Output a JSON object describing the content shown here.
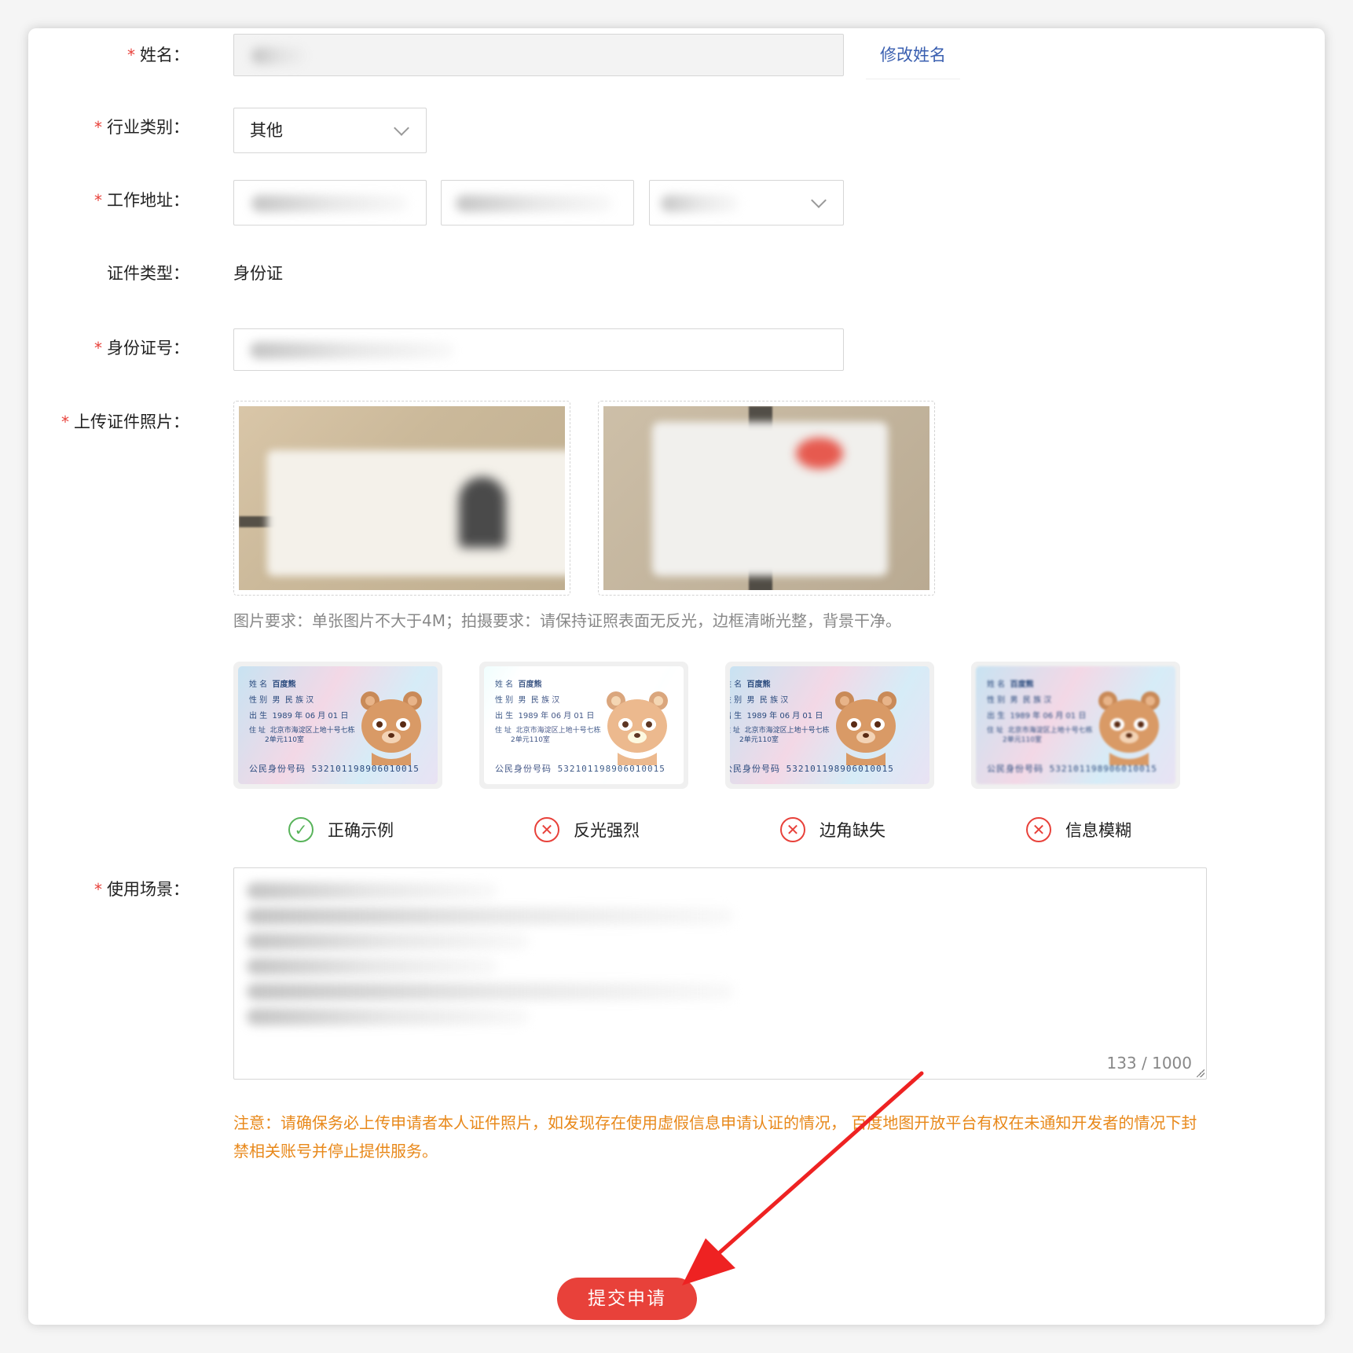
{
  "form": {
    "name": {
      "label": "姓名",
      "colon": "：",
      "edit_label": "修改姓名"
    },
    "industry": {
      "label": "行业类别",
      "colon": "：",
      "value": "其他"
    },
    "address": {
      "label": "工作地址",
      "colon": "："
    },
    "id_type": {
      "label": "证件类型：",
      "value": "身份证"
    },
    "id_number": {
      "label": "身份证号",
      "colon": "："
    },
    "upload": {
      "label": "上传证件照片",
      "colon": "：",
      "hint": "图片要求：单张图片不大于4M；拍摄要求：请保持证照表面无反光，边框清晰光整，背景干净。"
    },
    "samples": [
      {
        "verdict": "正确示例",
        "icon": "check-circle-icon",
        "ok": true
      },
      {
        "verdict": "反光强烈",
        "icon": "x-circle-icon",
        "ok": false
      },
      {
        "verdict": "边角缺失",
        "icon": "x-circle-icon",
        "ok": false
      },
      {
        "verdict": "信息模糊",
        "icon": "x-circle-icon",
        "ok": false
      }
    ],
    "sample_card": {
      "name_label": "姓 名",
      "name": "百度熊",
      "sex_label": "性 别",
      "sex": "男",
      "ethnic_label": "民 族",
      "ethnic": "汉",
      "birth_label": "出 生",
      "birth": "1989 年 06 月 01 日",
      "addr_label": "住 址",
      "addr_line1": "北京市海淀区上地十号七栋",
      "addr_line2": "2单元110室",
      "id_label": "公民身份号码",
      "id": "532101198906010015"
    },
    "scenario": {
      "label": "使用场景",
      "colon": "：",
      "counter": "133 / 1000"
    },
    "notice": "注意：请确保务必上传申请者本人证件照片，如发现存在使用虚假信息申请认证的情况， 百度地图开放平台有权在未通知开发者的情况下封禁相关账号并停止提供服务。",
    "submit_label": "提交申请"
  },
  "colors": {
    "accent": "#e8413a",
    "link": "#3a5fb0",
    "warning": "#e8881a",
    "ok": "#58b35a"
  }
}
